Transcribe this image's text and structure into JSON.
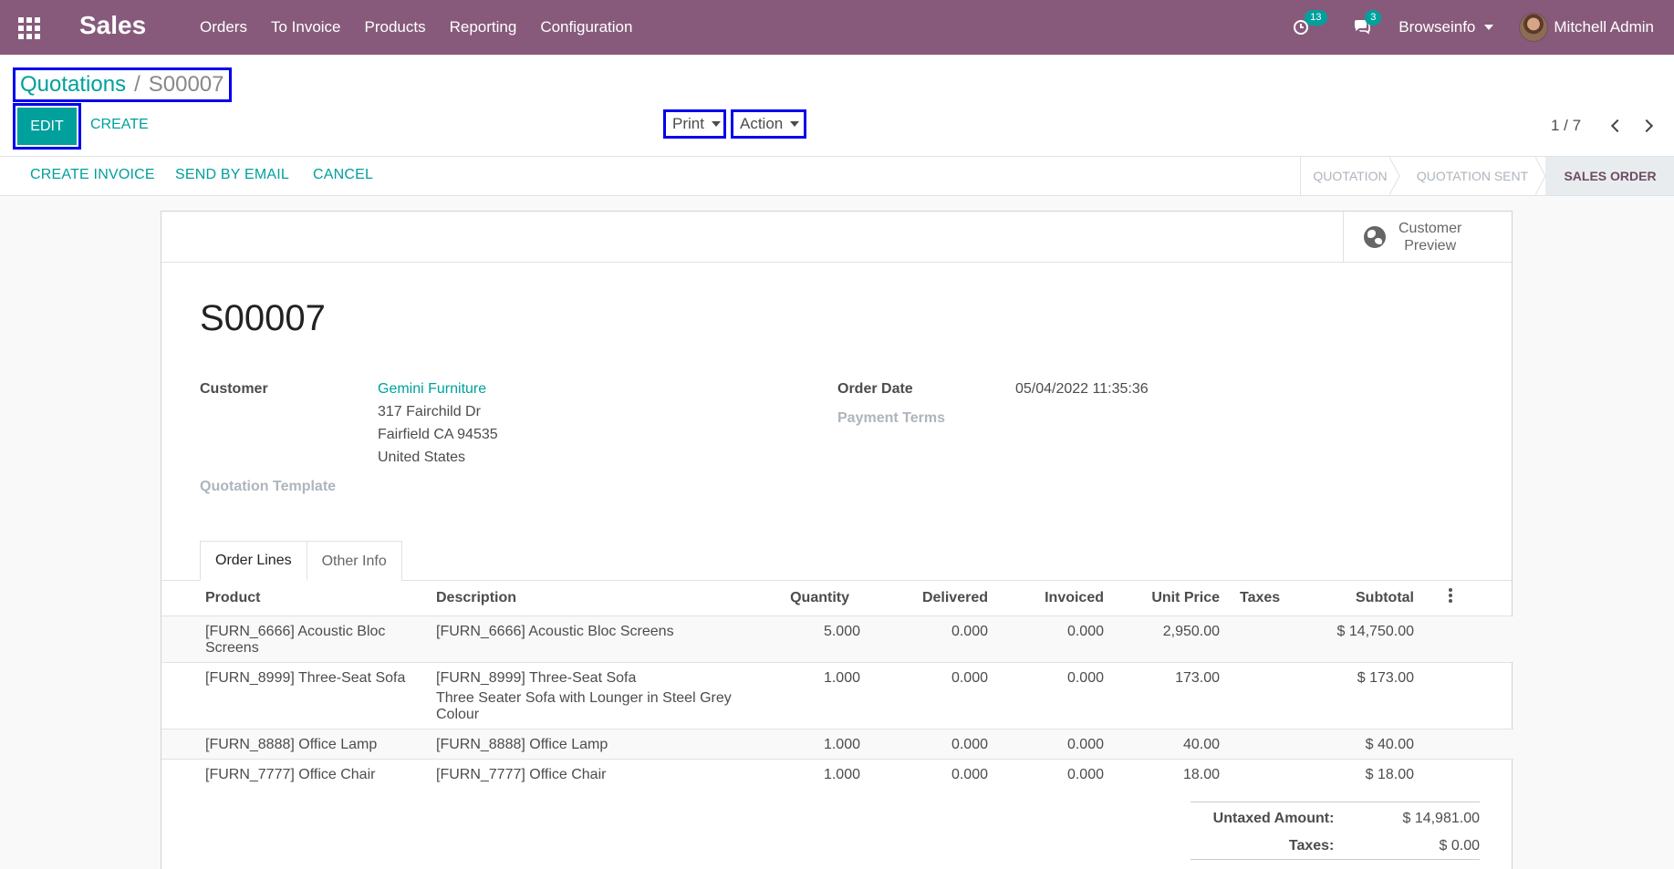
{
  "navbar": {
    "app_name": "Sales",
    "menu": [
      "Orders",
      "To Invoice",
      "Products",
      "Reporting",
      "Configuration"
    ],
    "activity_count": "13",
    "message_count": "3",
    "company": "Browseinfo",
    "user": "Mitchell Admin"
  },
  "breadcrumb": {
    "parent": "Quotations",
    "sep": "/",
    "current": "S00007"
  },
  "buttons": {
    "edit": "EDIT",
    "create": "CREATE",
    "print": "Print",
    "action": "Action"
  },
  "pager": "1 / 7",
  "statusbar": {
    "actions": [
      "CREATE INVOICE",
      "SEND BY EMAIL",
      "CANCEL"
    ],
    "stages": [
      "QUOTATION",
      "QUOTATION SENT",
      "SALES ORDER"
    ],
    "active_stage": "SALES ORDER"
  },
  "sheet": {
    "customer_preview": [
      "Customer",
      "Preview"
    ],
    "title": "S00007",
    "labels": {
      "customer": "Customer",
      "order_date": "Order Date",
      "payment_terms": "Payment Terms",
      "quotation_template": "Quotation Template"
    },
    "customer": {
      "name": "Gemini Furniture",
      "address1": "317 Fairchild Dr",
      "address2": "Fairfield CA 94535",
      "country": "United States"
    },
    "order_date": "05/04/2022 11:35:36",
    "tabs": [
      "Order Lines",
      "Other Info"
    ],
    "columns": [
      "Product",
      "Description",
      "Quantity",
      "Delivered",
      "Invoiced",
      "Unit Price",
      "Taxes",
      "Subtotal"
    ],
    "lines": [
      {
        "product": "[FURN_6666] Acoustic Bloc Screens",
        "description": "[FURN_6666] Acoustic Bloc Screens",
        "description2": "",
        "quantity": "5.000",
        "delivered": "0.000",
        "invoiced": "0.000",
        "unit_price": "2,950.00",
        "taxes": "",
        "subtotal": "$ 14,750.00"
      },
      {
        "product": "[FURN_8999] Three-Seat Sofa",
        "description": "[FURN_8999] Three-Seat Sofa",
        "description2": "Three Seater Sofa with Lounger in Steel Grey Colour",
        "quantity": "1.000",
        "delivered": "0.000",
        "invoiced": "0.000",
        "unit_price": "173.00",
        "taxes": "",
        "subtotal": "$ 173.00"
      },
      {
        "product": "[FURN_8888] Office Lamp",
        "description": "[FURN_8888] Office Lamp",
        "description2": "",
        "quantity": "1.000",
        "delivered": "0.000",
        "invoiced": "0.000",
        "unit_price": "40.00",
        "taxes": "",
        "subtotal": "$ 40.00"
      },
      {
        "product": "[FURN_7777] Office Chair",
        "description": "[FURN_7777] Office Chair",
        "description2": "",
        "quantity": "1.000",
        "delivered": "0.000",
        "invoiced": "0.000",
        "unit_price": "18.00",
        "taxes": "",
        "subtotal": "$ 18.00"
      }
    ],
    "totals": {
      "untaxed_label": "Untaxed Amount:",
      "untaxed_value": "$ 14,981.00",
      "taxes_label": "Taxes:",
      "taxes_value": "$ 0.00"
    }
  },
  "colors": {
    "navbar": "#875a7b",
    "accent": "#00a09d",
    "highlight_border": "#0000ee"
  }
}
